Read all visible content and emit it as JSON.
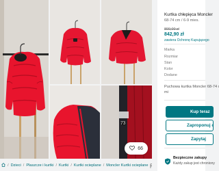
{
  "gallery": {
    "favourites_count": "66",
    "photo_tag": "73"
  },
  "breadcrumb": {
    "items": [
      "Dzieci",
      "Płaszcze i kurtki",
      "Kurtki",
      "Kurtki ocieplane",
      "Moncler Kurtki ocieplane"
    ],
    "home_icon": "home-icon",
    "report_icon": "flag-icon"
  },
  "item": {
    "title": "Kurtka chłepięca Moncler",
    "subtitle": "68-74 cm / 6-9 mies.",
    "old_price": "800,00 zł",
    "price": "842,90 zł",
    "protection": "zawiera Ochronę Kupującego",
    "attributes": [
      "Marka",
      "Rozmiar",
      "Stan",
      "Kolor",
      "Dodane"
    ],
    "description": "Puchowa kurtka Moncler 68-74 cm",
    "description_line2": "mi"
  },
  "actions": {
    "buy_label": "Kup teraz",
    "offer_label": "Zaproponuj cenę",
    "ask_label": "Zapytaj"
  },
  "safety": {
    "title": "Bezpieczne zakupy",
    "text": "Każdy zakup jest chroniony"
  },
  "colors": {
    "accent": "#007782",
    "jacket": "#e8102c"
  }
}
